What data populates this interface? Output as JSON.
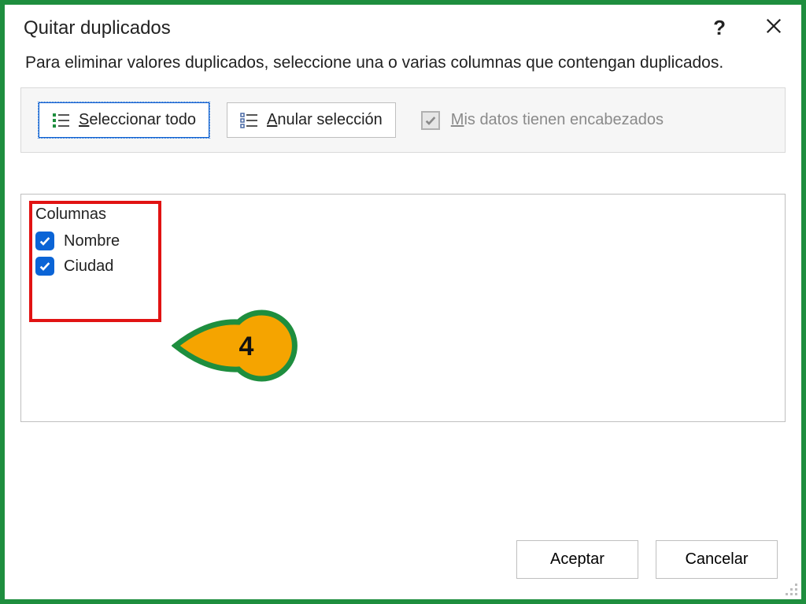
{
  "dialog": {
    "title": "Quitar duplicados",
    "description": "Para eliminar valores duplicados, seleccione una o varias columnas que contengan duplicados.",
    "buttons": {
      "select_all": "Seleccionar todo",
      "unselect_all": "Anular selección",
      "headers_checkbox_prefix": "M",
      "headers_checkbox_rest": "is datos tienen encabezados",
      "ok": "Aceptar",
      "cancel": "Cancelar"
    },
    "columns_header": "Columnas",
    "columns": [
      {
        "label": "Nombre",
        "checked": true
      },
      {
        "label": "Ciudad",
        "checked": true
      }
    ]
  },
  "annotation": {
    "number": "4"
  }
}
